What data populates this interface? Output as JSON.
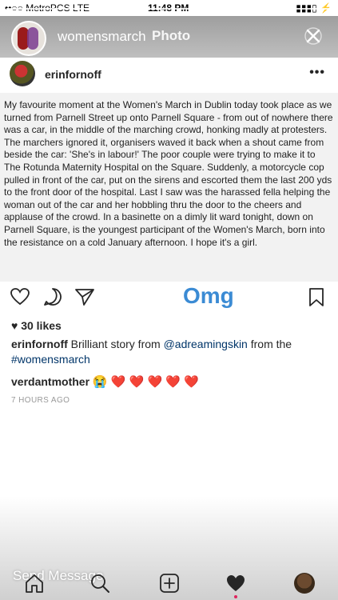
{
  "status_bar": {
    "carrier": "••○○ MetroPCS  LTE",
    "time": "11:48 PM",
    "battery": "▮▮▮▯ ⚡"
  },
  "story": {
    "username": "womensmarch",
    "screen_title": "Photo"
  },
  "post": {
    "username": "erinfornoff",
    "text": "My favourite moment at the Women's March in Dublin today took place as we turned from Parnell Street up onto Parnell Square - from out of nowhere there was a car, in the middle of the marching crowd, honking madly at protesters. The marchers ignored it, organisers waved it back when a shout came from beside the car: 'She's in labour!' The poor couple were trying to make it to The Rotunda Maternity Hospital on the Square. Suddenly, a motorcycle cop pulled in front of the car, put on the sirens and escorted them the last 200 yds to the front door of the hospital. Last I saw was the harassed fella helping the woman out of the car and her hobbling thru the door to the cheers and applause of the crowd. In a basinette on a dimly lit ward tonight, down on Parnell Square, is the youngest participant of the Women's March, born into the resistance on a cold January afternoon. I hope it's a girl.",
    "sticker": "Omg",
    "likes": "30 likes",
    "caption": {
      "user": "erinfornoff",
      "text_a": "Brilliant story from",
      "mention": "@adreamingskin",
      "text_b": "from the",
      "hashtag": "#womensmarch"
    },
    "comment": {
      "user": "verdantmother",
      "emojis": "😭 ❤️ ❤️ ❤️ ❤️ ❤️"
    },
    "timestamp": "7 HOURS AGO"
  },
  "bottom": {
    "send_message": "Send Message"
  },
  "colors": {
    "accent_blue": "#3b8bd4",
    "link": "#003569",
    "heart": "#e0245e"
  }
}
